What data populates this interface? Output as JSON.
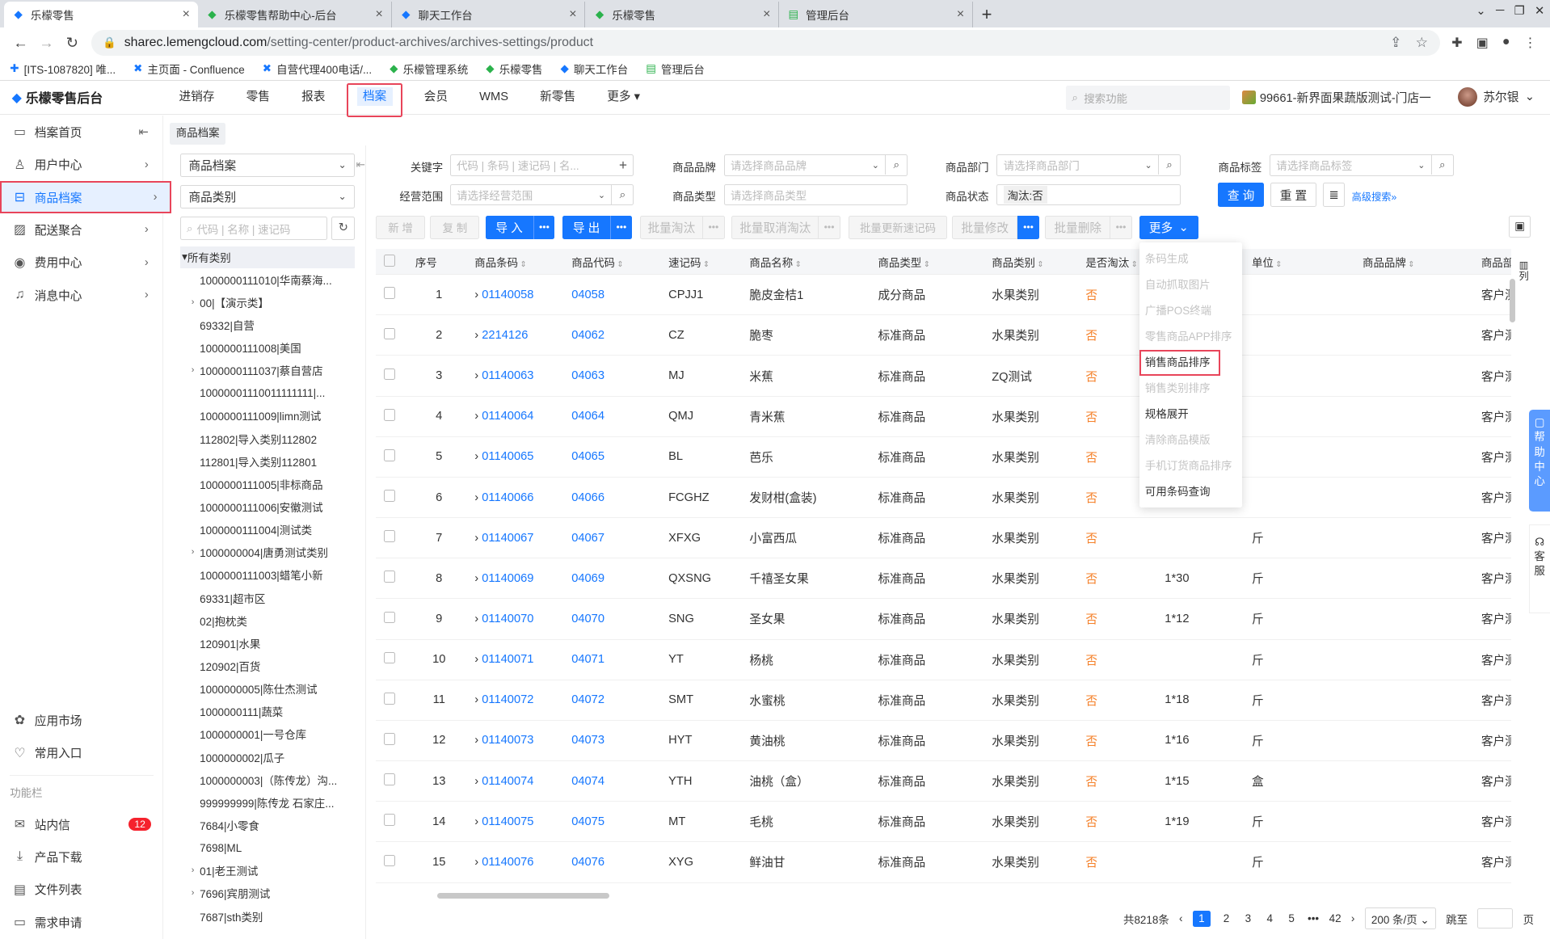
{
  "browser": {
    "tabs": [
      {
        "label": "乐檬零售",
        "active": true
      },
      {
        "label": "乐檬零售帮助中心-后台",
        "active": false
      },
      {
        "label": "聊天工作台",
        "active": false
      },
      {
        "label": "乐檬零售",
        "active": false
      },
      {
        "label": "管理后台",
        "active": false
      }
    ],
    "new_tab": "+",
    "url_host": "sharec.lemengcloud.com",
    "url_path": "/setting-center/product-archives/archives-settings/product",
    "bookmarks": [
      "[ITS-1087820] 唯...",
      "主页面 - Confluence",
      "自营代理400电话/...",
      "乐檬管理系统",
      "乐檬零售",
      "聊天工作台",
      "管理后台"
    ]
  },
  "header": {
    "logo": "乐檬零售后台",
    "nav": [
      "进销存",
      "零售",
      "报表",
      "档案",
      "会员",
      "WMS",
      "新零售",
      "更多"
    ],
    "active_nav": "档案",
    "search_placeholder": "搜索功能",
    "store": "99661-新界面果蔬版测试-门店一",
    "user": "苏尔银"
  },
  "sidebar": {
    "items": [
      {
        "label": "档案首页",
        "icon": "home-icon"
      },
      {
        "label": "用户中心",
        "icon": "user-icon"
      },
      {
        "label": "商品档案",
        "icon": "product-icon"
      },
      {
        "label": "配送聚合",
        "icon": "delivery-icon"
      },
      {
        "label": "费用中心",
        "icon": "fee-icon"
      },
      {
        "label": "消息中心",
        "icon": "bell-icon"
      }
    ],
    "bottom": {
      "app_market": "应用市场",
      "common_entry": "常用入口",
      "group_label": "功能栏",
      "inbox": "站内信",
      "inbox_count": "12",
      "download": "产品下载",
      "files": "文件列表",
      "request": "需求申请"
    }
  },
  "breadcrumb": "商品档案",
  "tree": {
    "select1": "商品档案",
    "select2": "商品类别",
    "search_placeholder": "代码 | 名称 | 速记码",
    "root": "所有类别",
    "nodes": [
      {
        "label": "1000000111010|华南蔡海...",
        "exp": false
      },
      {
        "label": "00|【演示类】",
        "exp": true
      },
      {
        "label": "69332|自营",
        "exp": false
      },
      {
        "label": "1000000111008|美国",
        "exp": false
      },
      {
        "label": "1000000111037|蔡自营店",
        "exp": true
      },
      {
        "label": "10000001110011111111|...",
        "exp": false
      },
      {
        "label": "1000000111009|limn测试",
        "exp": false
      },
      {
        "label": "112802|导入类别112802",
        "exp": false
      },
      {
        "label": "112801|导入类别112801",
        "exp": false
      },
      {
        "label": "1000000111005|非标商品",
        "exp": false
      },
      {
        "label": "1000000111006|安徽测试",
        "exp": false
      },
      {
        "label": "1000000111004|测试类",
        "exp": false
      },
      {
        "label": "1000000004|唐勇测试类别",
        "exp": true
      },
      {
        "label": "1000000111003|蜡笔小新",
        "exp": false
      },
      {
        "label": "69331|超市区",
        "exp": false
      },
      {
        "label": "02|抱枕类",
        "exp": false
      },
      {
        "label": "120901|水果",
        "exp": false
      },
      {
        "label": "120902|百货",
        "exp": false
      },
      {
        "label": "1000000005|陈仕杰测试",
        "exp": false
      },
      {
        "label": "1000000111|蔬菜",
        "exp": false
      },
      {
        "label": "1000000001|一号仓库",
        "exp": false
      },
      {
        "label": "1000000002|瓜子",
        "exp": false
      },
      {
        "label": "1000000003|（陈传龙）沟...",
        "exp": false
      },
      {
        "label": "999999999|陈传龙 石家庄...",
        "exp": false
      },
      {
        "label": "7684|小零食",
        "exp": false
      },
      {
        "label": "7698|ML",
        "exp": false
      },
      {
        "label": "01|老王测试",
        "exp": true
      },
      {
        "label": "7696|宾朋测试",
        "exp": true
      },
      {
        "label": "7687|sth类别",
        "exp": false
      }
    ]
  },
  "filters": {
    "keyword_label": "关键字",
    "keyword_ph": "代码 | 条码 | 速记码 | 名...",
    "brand_label": "商品品牌",
    "brand_ph": "请选择商品品牌",
    "dept_label": "商品部门",
    "dept_ph": "请选择商品部门",
    "tag_label": "商品标签",
    "tag_ph": "请选择商品标签",
    "scope_label": "经营范围",
    "scope_ph": "请选择经营范围",
    "type_label": "商品类型",
    "type_ph": "请选择商品类型",
    "status_label": "商品状态",
    "status_value": "淘汰:否",
    "query": "查 询",
    "reset": "重 置",
    "advanced": "高级搜索"
  },
  "toolbar": {
    "add": "新 增",
    "copy": "复 制",
    "import": "导 入",
    "export": "导 出",
    "batch_eliminate": "批量淘汰",
    "batch_cancel": "批量取消淘汰",
    "batch_update": "批量更新速记码",
    "batch_modify": "批量修改",
    "batch_delete": "批量删除",
    "more": "更多"
  },
  "more_menu": [
    "条码生成",
    "自动抓取图片",
    "广播POS终端",
    "零售商品APP排序",
    "销售商品排序",
    "销售类别排序",
    "规格展开",
    "清除商品模版",
    "手机订货商品排序",
    "可用条码查询"
  ],
  "more_menu_enabled": [
    false,
    false,
    false,
    false,
    true,
    false,
    true,
    false,
    false,
    true
  ],
  "table": {
    "headers": [
      "序号",
      "商品条码",
      "商品代码",
      "速记码",
      "商品名称",
      "商品类型",
      "商品类别",
      "是否淘汰",
      "",
      "单位",
      "商品品牌",
      "商品部门"
    ],
    "rows": [
      [
        "1",
        "01140058",
        "04058",
        "CPJJ1",
        "脆皮金桔1",
        "成分商品",
        "水果类别",
        "否",
        "",
        "",
        "",
        "客户测试"
      ],
      [
        "2",
        "2214126",
        "04062",
        "CZ",
        "脆枣",
        "标准商品",
        "水果类别",
        "否",
        "",
        "",
        "",
        "客户测试"
      ],
      [
        "3",
        "01140063",
        "04063",
        "MJ",
        "米蕉",
        "标准商品",
        "ZQ测试",
        "否",
        "",
        "",
        "",
        "客户测试"
      ],
      [
        "4",
        "01140064",
        "04064",
        "QMJ",
        "青米蕉",
        "标准商品",
        "水果类别",
        "否",
        "",
        "",
        "",
        "客户测试"
      ],
      [
        "5",
        "01140065",
        "04065",
        "BL",
        "芭乐",
        "标准商品",
        "水果类别",
        "否",
        "",
        "",
        "",
        "客户测试"
      ],
      [
        "6",
        "01140066",
        "04066",
        "FCGHZ",
        "发财柑(盒装)",
        "标准商品",
        "水果类别",
        "否",
        "",
        "",
        "",
        "客户测试"
      ],
      [
        "7",
        "01140067",
        "04067",
        "XFXG",
        "小富西瓜",
        "标准商品",
        "水果类别",
        "否",
        "",
        "斤",
        "",
        "客户测试"
      ],
      [
        "8",
        "01140069",
        "04069",
        "QXSNG",
        "千禧圣女果",
        "标准商品",
        "水果类别",
        "否",
        "1*30",
        "斤",
        "",
        "客户测试"
      ],
      [
        "9",
        "01140070",
        "04070",
        "SNG",
        "圣女果",
        "标准商品",
        "水果类别",
        "否",
        "1*12",
        "斤",
        "",
        "客户测试"
      ],
      [
        "10",
        "01140071",
        "04071",
        "YT",
        "杨桃",
        "标准商品",
        "水果类别",
        "否",
        "",
        "斤",
        "",
        "客户测试"
      ],
      [
        "11",
        "01140072",
        "04072",
        "SMT",
        "水蜜桃",
        "标准商品",
        "水果类别",
        "否",
        "1*18",
        "斤",
        "",
        "客户测试"
      ],
      [
        "12",
        "01140073",
        "04073",
        "HYT",
        "黄油桃",
        "标准商品",
        "水果类别",
        "否",
        "1*16",
        "斤",
        "",
        "客户测试"
      ],
      [
        "13",
        "01140074",
        "04074",
        "YTH",
        "油桃（盒）",
        "标准商品",
        "水果类别",
        "否",
        "1*15",
        "盒",
        "",
        "客户测试"
      ],
      [
        "14",
        "01140075",
        "04075",
        "MT",
        "毛桃",
        "标准商品",
        "水果类别",
        "否",
        "1*19",
        "斤",
        "",
        "客户测试"
      ],
      [
        "15",
        "01140076",
        "04076",
        "XYG",
        "鲜油甘",
        "标准商品",
        "水果类别",
        "否",
        "",
        "斤",
        "",
        "客户测试"
      ]
    ]
  },
  "pagination": {
    "total": "共8218条",
    "pages": [
      "1",
      "2",
      "3",
      "4",
      "5",
      "•••",
      "42"
    ],
    "current": "1",
    "page_size": "200 条/页",
    "goto": "跳至",
    "page_suffix": "页"
  },
  "right_panel": {
    "columns_label": "列",
    "help": "帮助中心",
    "service": "客服"
  }
}
